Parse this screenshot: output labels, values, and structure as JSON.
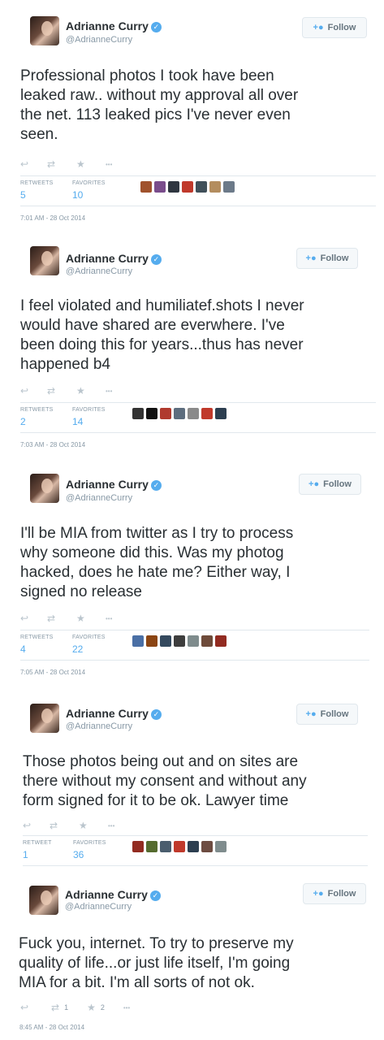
{
  "user": {
    "name": "Adrianne Curry",
    "handle": "@AdrianneCurry",
    "verified_glyph": "✓"
  },
  "follow_label": "Follow",
  "follow_icon": "person-plus",
  "icons": {
    "reply": "↩",
    "retweet": "⇄",
    "favorite": "★",
    "more": "•••"
  },
  "colors": {
    "accent": "#55acee",
    "muted": "#8899a6",
    "text": "#292f33"
  },
  "tweets": [
    {
      "lines": [
        "Professional photos I took have been",
        "leaked raw.. without my approval all over",
        "the net. 113 leaked pics I've  never even",
        "seen."
      ],
      "retweets_label": "RETWEETS",
      "retweets": "5",
      "favorites_label": "FAVORITES",
      "favorites": "10",
      "date": "7:01 AM - 28 Oct 2014"
    },
    {
      "lines": [
        "I feel violated and humiliatef.shots I never",
        "would have shared are everwhere. I've",
        "been doing this for years...thus has never",
        "happened b4"
      ],
      "retweets_label": "RETWEETS",
      "retweets": "2",
      "favorites_label": "FAVORITES",
      "favorites": "14",
      "date": "7:03 AM - 28 Oct 2014"
    },
    {
      "lines": [
        "I'll be MIA from twitter as I try to process",
        "why someone did this. Was my photog",
        "hacked, does he hate me? Either way, I",
        "signed no release"
      ],
      "retweets_label": "RETWEETS",
      "retweets": "4",
      "favorites_label": "FAVORITES",
      "favorites": "22",
      "date": "7:05 AM - 28 Oct 2014"
    },
    {
      "lines": [
        "Those photos being out and on sites are",
        "there without my consent and without any",
        "form signed for it to be ok. Lawyer time"
      ],
      "retweets_label": "RETWEET",
      "retweets": "1",
      "favorites_label": "FAVORITES",
      "favorites": "36",
      "date": ""
    },
    {
      "lines": [
        "Fuck you, internet. To try to preserve my",
        "quality of life...or just life itself, I'm going",
        "MIA for a bit. I'm all sorts of not ok."
      ],
      "retweet_count": "1",
      "favorite_count": "2",
      "date": "8:45 AM - 28 Oct 2014"
    }
  ]
}
